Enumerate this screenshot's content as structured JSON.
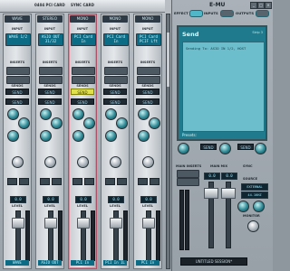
{
  "header": {
    "title1": "0404 PCI CARD",
    "title2": "SYNC CARD"
  },
  "strips": [
    {
      "type": "WAVE",
      "input": "WAVE 1/2",
      "send": "SEND",
      "send_hl": false,
      "gain": "0.0",
      "level": "0.0",
      "name": "WAVE",
      "selected": false
    },
    {
      "type": "STEREO",
      "input": "ASIO OUT 31/32",
      "send": "SEND",
      "send_hl": false,
      "gain": "0.0",
      "level": "0.0",
      "name": "ASIO OUT",
      "selected": false
    },
    {
      "type": "MONO",
      "input": "PCI Card In",
      "send": "SEND",
      "send_hl": true,
      "gain": "0.0",
      "level": "0.0",
      "name": "PCI In",
      "selected": true
    },
    {
      "type": "MONO",
      "input": "PCI Card In",
      "send": "SEND",
      "send_hl": false,
      "gain": "0.0",
      "level": "0.0",
      "name": "PCI In 1L",
      "selected": false
    },
    {
      "type": "MONO",
      "input": "PCI Card PCIF Lft",
      "send": "SEND",
      "send_hl": false,
      "gain": "0.0",
      "level": "0.0",
      "name": "PCI In",
      "selected": false
    }
  ],
  "strip_labels": {
    "input": "INPUT",
    "inserts": "INSERTS",
    "sends": "SENDS",
    "level": "LEVEL"
  },
  "right_panel": {
    "logo": "E-MU",
    "tabs": [
      "EFFECT",
      "INPUTS",
      "OUTPUTS"
    ],
    "screen_title": "Send",
    "screen_strip": "Strip 3",
    "screen_line": "Sending To:  ASIO IN 1/2, HOST",
    "preset": "Presets:",
    "main_inserts": "MAIN INSERTS",
    "main_mix": "MAIN MIX",
    "sync": "SYNC",
    "source": "SOURCE",
    "source_val": "EXTERNAL",
    "rate_val": "44.1KHZ",
    "monitor": "MONITOR",
    "level1": "0.0",
    "level2": "0.0",
    "session": "UNTITLED SESSION*",
    "send_btns": [
      "SEND",
      "SEND"
    ]
  },
  "colors": {
    "accent": "#1e7a8c",
    "selected_strip": "#b05266",
    "highlight_send": "#e0e14a"
  }
}
